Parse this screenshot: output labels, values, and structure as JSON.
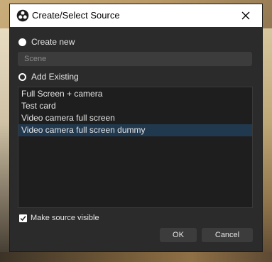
{
  "window": {
    "title": "Create/Select Source",
    "app_icon": "obs-logo-icon",
    "close_icon": "close-icon"
  },
  "create_new": {
    "label": "Create new",
    "selected": false,
    "input_placeholder": "Scene",
    "input_value": ""
  },
  "add_existing": {
    "label": "Add Existing",
    "selected": true
  },
  "sources": [
    {
      "name": "Full Screen + camera",
      "selected": false
    },
    {
      "name": "Test card",
      "selected": false
    },
    {
      "name": "Video camera full screen",
      "selected": false
    },
    {
      "name": "Video camera full screen dummy",
      "selected": true
    }
  ],
  "make_visible": {
    "label": "Make source visible",
    "checked": true
  },
  "buttons": {
    "ok": "OK",
    "cancel": "Cancel"
  },
  "colors": {
    "dialog_bg": "#2b2b2b",
    "list_bg": "#1e1e1e",
    "selection": "#21394f",
    "button_bg": "#3c3c3c"
  }
}
